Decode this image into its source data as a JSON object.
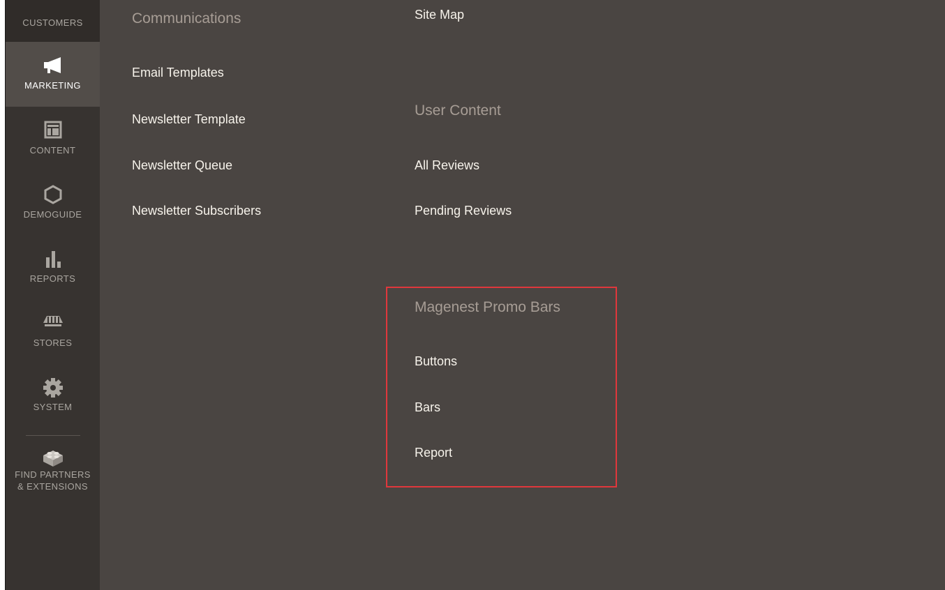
{
  "sidebar": {
    "items": [
      {
        "label": "CUSTOMERS",
        "icon": "customers-icon"
      },
      {
        "label": "MARKETING",
        "icon": "megaphone-icon",
        "active": true
      },
      {
        "label": "CONTENT",
        "icon": "content-layout-icon"
      },
      {
        "label": "DEMOGUIDE",
        "icon": "hexagon-icon"
      },
      {
        "label": "REPORTS",
        "icon": "bar-chart-icon"
      },
      {
        "label": "STORES",
        "icon": "storefront-icon"
      },
      {
        "label": "SYSTEM",
        "icon": "gear-icon"
      },
      {
        "label": "FIND PARTNERS & EXTENSIONS",
        "line1": "FIND PARTNERS",
        "line2": "& EXTENSIONS",
        "icon": "lego-brick-icon"
      }
    ]
  },
  "menu": {
    "communications": {
      "title": "Communications",
      "links": [
        "Email Templates",
        "Newsletter Template",
        "Newsletter Queue",
        "Newsletter Subscribers"
      ]
    },
    "seo": {
      "links": [
        "Site Map"
      ]
    },
    "user_content": {
      "title": "User Content",
      "links": [
        "All Reviews",
        "Pending Reviews"
      ]
    },
    "promo_bars": {
      "title": "Magenest Promo Bars",
      "links": [
        "Buttons",
        "Bars",
        "Report"
      ]
    }
  },
  "colors": {
    "menu_background": "#4a4542",
    "sidebar_background": "#373330",
    "active_item": "#524d49",
    "highlight_border": "#e0373c"
  }
}
